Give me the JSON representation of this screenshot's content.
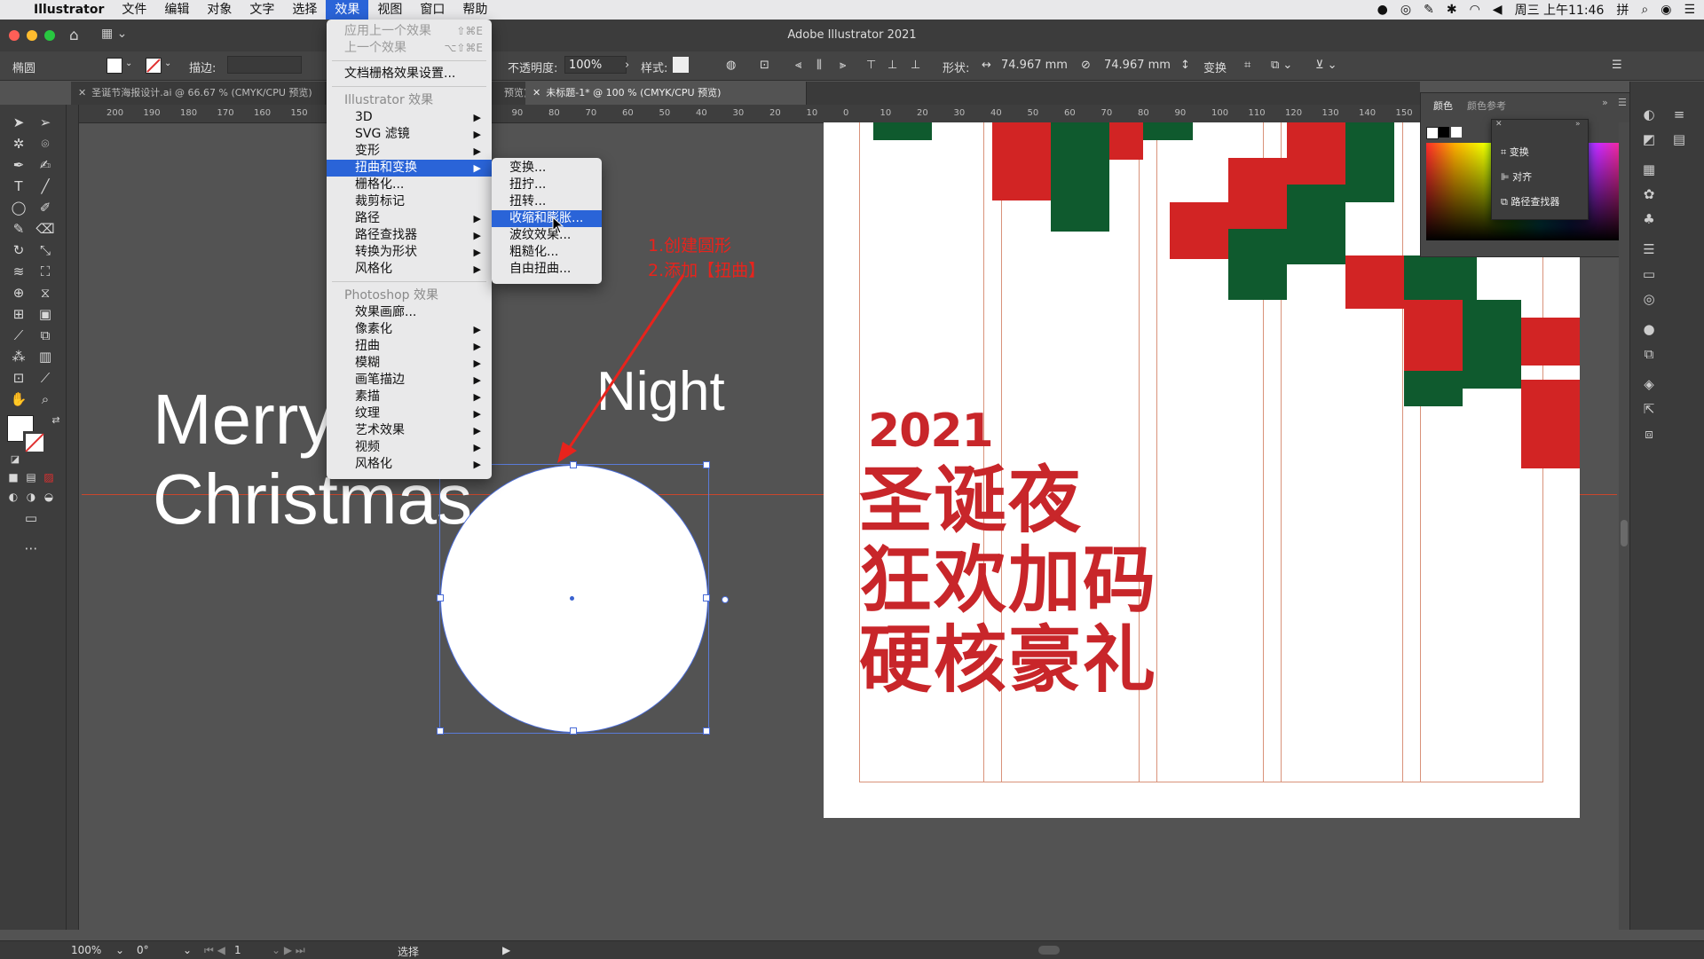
{
  "menubar": {
    "app": "Illustrator",
    "items": [
      "文件",
      "编辑",
      "对象",
      "文字",
      "选择",
      "效果",
      "视图",
      "窗口",
      "帮助"
    ],
    "active_index": 5,
    "clock": "周三 上午11:46"
  },
  "window": {
    "title": "Adobe Illustrator 2021"
  },
  "control_bar": {
    "object_type": "椭圆",
    "stroke_label": "描边:",
    "opacity_label": "不透明度:",
    "opacity_value": "100%",
    "style_label": "样式:",
    "shape_label": "形状:",
    "width_value": "74.967 mm",
    "height_value": "74.967 mm",
    "transform_label": "变换"
  },
  "tabs": [
    {
      "label": "圣诞节海报设计.ai @ 66.67 % (CMYK/CPU 预览)",
      "active": false
    },
    {
      "label": "预览)",
      "active": false
    },
    {
      "label": "未标题-1* @ 100 % (CMYK/CPU 预览)",
      "active": true
    }
  ],
  "ruler_ticks": [
    "200",
    "190",
    "180",
    "170",
    "160",
    "150",
    "140",
    "130",
    "120",
    "110",
    "100",
    "90",
    "80",
    "70",
    "60",
    "50",
    "40",
    "30",
    "20",
    "10",
    "0",
    "10",
    "20",
    "30",
    "40",
    "50",
    "60",
    "70",
    "80",
    "90",
    "100",
    "110",
    "120",
    "130",
    "140",
    "150",
    "160"
  ],
  "effect_menu": {
    "apply_last": "应用上一个效果",
    "apply_last_sc": "⇧⌘E",
    "last_effect": "上一个效果",
    "last_effect_sc": "⌥⇧⌘E",
    "doc_raster": "文档栅格效果设置...",
    "illustrator_header": "Illustrator 效果",
    "illustrator_items": [
      "3D",
      "SVG 滤镜",
      "变形",
      "扭曲和变换",
      "栅格化...",
      "裁剪标记",
      "路径",
      "路径查找器",
      "转换为形状",
      "风格化"
    ],
    "photoshop_header": "Photoshop 效果",
    "photoshop_items": [
      "效果画廊...",
      "像素化",
      "扭曲",
      "模糊",
      "画笔描边",
      "素描",
      "纹理",
      "艺术效果",
      "视频",
      "风格化"
    ]
  },
  "distort_submenu": {
    "items": [
      "变换...",
      "扭拧...",
      "扭转...",
      "收缩和膨胀...",
      "波纹效果...",
      "粗糙化...",
      "自由扭曲..."
    ],
    "highlight_index": 3
  },
  "annotation": {
    "line1": "1.创建圆形",
    "line2": "2.添加【扭曲】"
  },
  "canvas_text": {
    "merry": "Merry",
    "christmas": "Christmas",
    "night": "Night"
  },
  "poster": {
    "year": "2021",
    "line1": "圣诞夜",
    "line2": "狂欢加码",
    "line3": "硬核豪礼"
  },
  "color_panel": {
    "tab1": "颜色",
    "tab2": "颜色参考"
  },
  "float_panel": {
    "items": [
      "变换",
      "对齐",
      "路径查找器"
    ]
  },
  "status_bar": {
    "zoom": "100%",
    "rotate": "0°",
    "page": "1",
    "tool": "选择"
  },
  "colors": {
    "menu_highlight": "#2a64d8",
    "poster_red": "#d22424",
    "poster_green": "#0f5a2e",
    "annotation_red": "#e8231c"
  }
}
